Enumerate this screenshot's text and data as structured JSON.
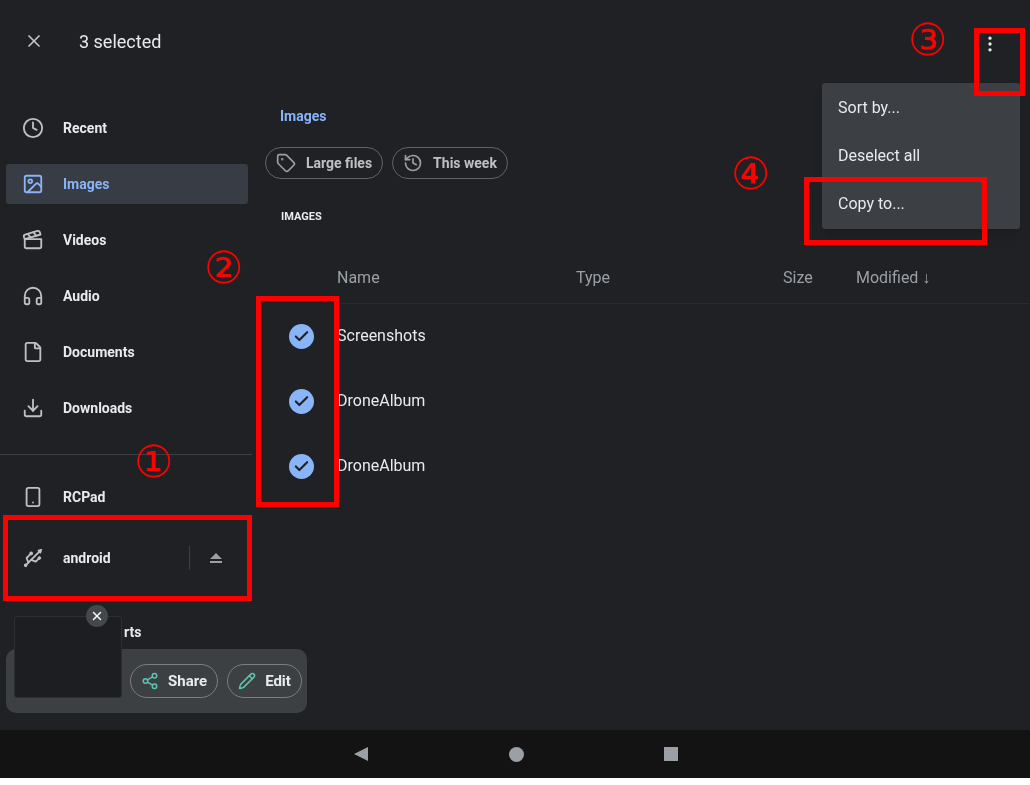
{
  "top_bar": {
    "title": "3 selected"
  },
  "sidebar": {
    "items": [
      {
        "label": "Recent",
        "selected": false
      },
      {
        "label": "Images",
        "selected": true
      },
      {
        "label": "Videos",
        "selected": false
      },
      {
        "label": "Audio",
        "selected": false
      },
      {
        "label": "Documents",
        "selected": false
      },
      {
        "label": "Downloads",
        "selected": false
      }
    ],
    "devices": [
      {
        "label": "RCPad"
      },
      {
        "label": "android"
      }
    ],
    "partial_item": "rts"
  },
  "breadcrumb": "Images",
  "chips": [
    {
      "label": "Large files"
    },
    {
      "label": "This week"
    }
  ],
  "section_heading": "IMAGES",
  "table": {
    "columns": [
      "Name",
      "Type",
      "Size",
      "Modified ↓"
    ],
    "rows": [
      {
        "name": "Screenshots",
        "checked": true
      },
      {
        "name": "DroneAlbum",
        "checked": true
      },
      {
        "name": "DroneAlbum",
        "checked": true
      }
    ]
  },
  "menu": {
    "items": [
      "Sort by...",
      "Deselect all",
      "Copy to..."
    ]
  },
  "toast": {
    "buttons": [
      {
        "label": "Share"
      },
      {
        "label": "Edit"
      }
    ]
  },
  "annotations": [
    {
      "label": "①"
    },
    {
      "label": "②"
    },
    {
      "label": "③"
    },
    {
      "label": "④"
    }
  ]
}
